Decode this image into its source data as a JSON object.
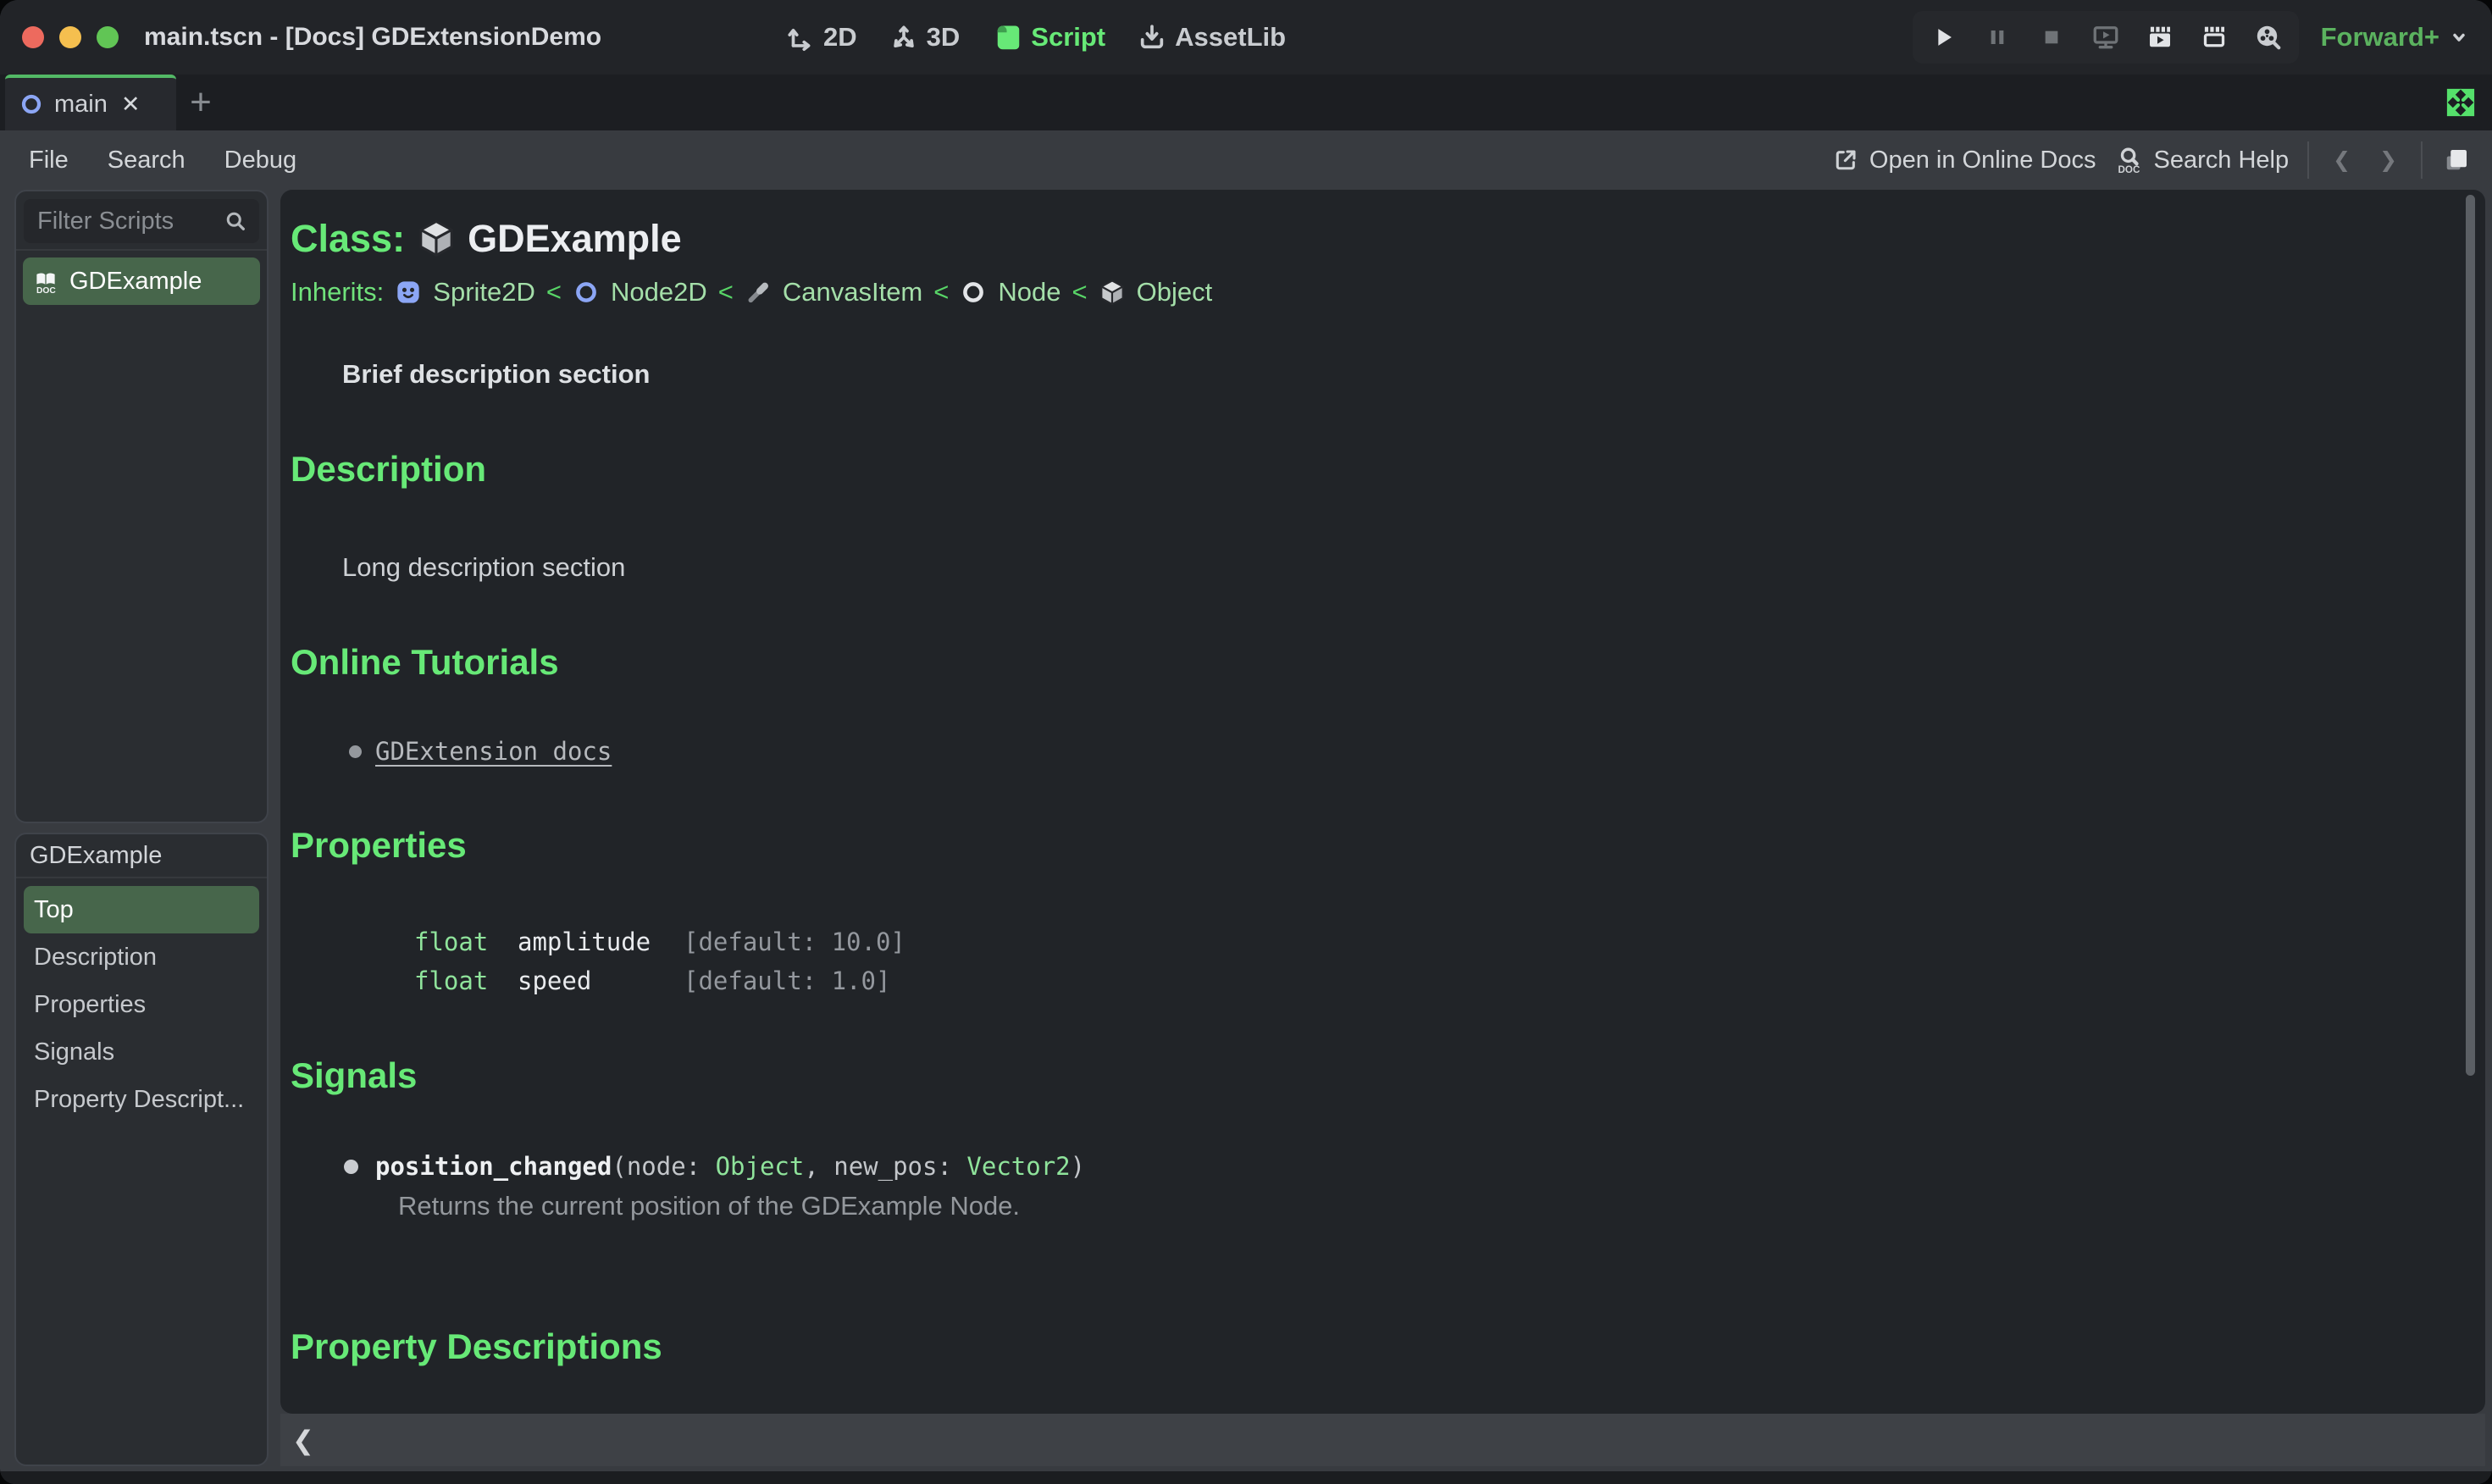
{
  "colors": {
    "accent-green": "#5bb25f",
    "heading-green": "#67e977",
    "inherits-link-green": "#a4dfa9",
    "type-green": "#8fe39b",
    "separator-green": "#58d567",
    "selected-bg": "#47664b",
    "tab-accent": "#53b966",
    "expand-green": "#55e06b",
    "node-blue": "#8ca6f5"
  },
  "icons": {
    "close": "✕",
    "add": "+",
    "back": "❮",
    "forward": "❯",
    "collapse": "❮"
  },
  "titlebar": {
    "title": "main.tscn - [Docs] GDExtensionDemo",
    "modes": [
      {
        "label": "2D"
      },
      {
        "label": "3D"
      },
      {
        "label": "Script"
      },
      {
        "label": "AssetLib"
      }
    ],
    "renderer": "Forward+"
  },
  "tabbar": {
    "tab": "main"
  },
  "menubar": {
    "file": "File",
    "search": "Search",
    "debug": "Debug",
    "open_online_docs": "Open in Online Docs",
    "search_help": "Search Help"
  },
  "scripts_panel": {
    "filter_placeholder": "Filter Scripts",
    "selected_script": "GDExample"
  },
  "members_panel": {
    "header": "GDExample",
    "items": [
      "Top",
      "Description",
      "Properties",
      "Signals",
      "Property Descript..."
    ]
  },
  "doc": {
    "class_label": "Class:",
    "class_name": "GDExample",
    "inherits_label": "Inherits:",
    "separator": "<",
    "inherits": [
      "Sprite2D",
      "Node2D",
      "CanvasItem",
      "Node",
      "Object"
    ],
    "brief": "Brief description section",
    "description_heading": "Description",
    "description_text": "Long description section",
    "tutorials_heading": "Online Tutorials",
    "tutorial_link": "GDExtension docs",
    "properties_heading": "Properties",
    "properties": [
      {
        "type": "float",
        "name": "amplitude",
        "default": "[default: 10.0]"
      },
      {
        "type": "float",
        "name": "speed",
        "default": "[default: 1.0]"
      }
    ],
    "signals_heading": "Signals",
    "signal": {
      "name": "position_changed",
      "open": "(node: ",
      "arg1_type": "Object",
      "mid": ", new_pos: ",
      "arg2_type": "Vector2",
      "close": ")",
      "description": "Returns the current position of the GDExample Node."
    },
    "property_descriptions_heading": "Property Descriptions"
  }
}
